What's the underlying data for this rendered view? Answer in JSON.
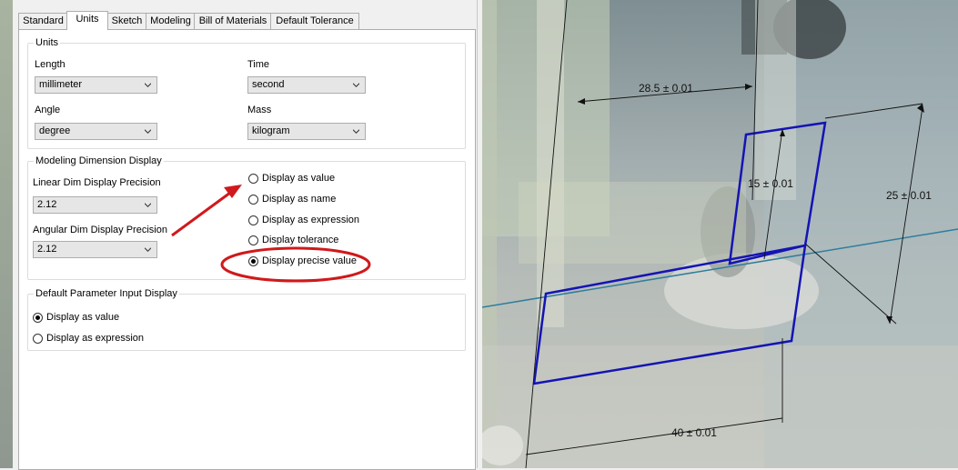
{
  "tabs": [
    "Standard",
    "Units",
    "Sketch",
    "Modeling",
    "Bill of Materials",
    "Default Tolerance"
  ],
  "active_tab": "Units",
  "units": {
    "title": "Units",
    "length": {
      "label": "Length",
      "value": "millimeter"
    },
    "time": {
      "label": "Time",
      "value": "second"
    },
    "angle": {
      "label": "Angle",
      "value": "degree"
    },
    "mass": {
      "label": "Mass",
      "value": "kilogram"
    }
  },
  "modeling_display": {
    "title": "Modeling Dimension Display",
    "linear_label": "Linear Dim Display Precision",
    "linear_value": "2.12",
    "angular_label": "Angular Dim Display Precision",
    "angular_value": "2.12",
    "options": [
      {
        "label": "Display as value",
        "checked": false
      },
      {
        "label": "Display as name",
        "checked": false
      },
      {
        "label": "Display as expression",
        "checked": false
      },
      {
        "label": "Display tolerance",
        "checked": false
      },
      {
        "label": "Display precise value",
        "checked": true
      }
    ]
  },
  "param_input": {
    "title": "Default Parameter Input Display",
    "options": [
      {
        "label": "Display as value",
        "checked": true
      },
      {
        "label": "Display as expression",
        "checked": false
      }
    ]
  },
  "annotation_color": "#d0191b",
  "sketch_color": "#1414b4",
  "dimensions": {
    "d_top": "28.5 ± 0.01",
    "d_inner": "15 ± 0.01",
    "d_right": "25 ± 0.01",
    "d_bottom": "40 ± 0.01"
  }
}
